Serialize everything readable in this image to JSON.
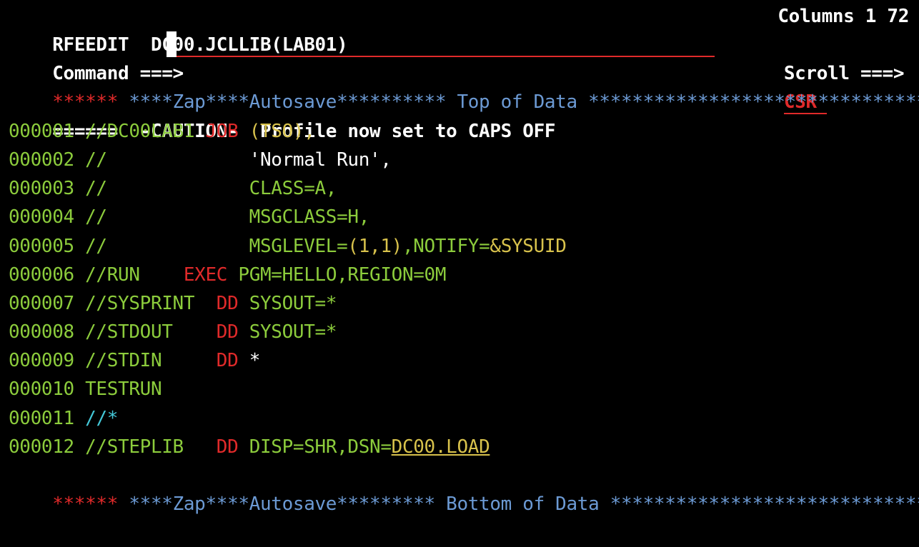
{
  "header": {
    "app": "RFEEDIT",
    "dataset": "DC00.JCLLIB(LAB01)",
    "columns_label": "Columns 1 72"
  },
  "command": {
    "label": "Command ===>",
    "value": "",
    "scroll_label": "Scroll ===>",
    "scroll_value": "CSR"
  },
  "top_marker": {
    "stars": "******",
    "text": " ****Zap****Autosave********** Top of Data *******************************"
  },
  "caution": {
    "flag": "======",
    "text": "  -CAUTION-  Profile now set to CAPS OFF"
  },
  "lines": [
    {
      "num": "000001",
      "parts": [
        {
          "t": " //DC00LAB1 ",
          "c": "green"
        },
        {
          "t": "JOB",
          "c": "red"
        },
        {
          "t": " (TSO),",
          "c": "yellow"
        }
      ]
    },
    {
      "num": "000002",
      "parts": [
        {
          "t": " //             ",
          "c": "green"
        },
        {
          "t": "'Normal Run',",
          "c": "white"
        }
      ]
    },
    {
      "num": "000003",
      "parts": [
        {
          "t": " //             CLASS=A,",
          "c": "green"
        }
      ]
    },
    {
      "num": "000004",
      "parts": [
        {
          "t": " //             MSGCLASS=H,",
          "c": "green"
        }
      ]
    },
    {
      "num": "000005",
      "parts": [
        {
          "t": " //             MSGLEVEL=",
          "c": "green"
        },
        {
          "t": "(1,1)",
          "c": "yellow"
        },
        {
          "t": ",NOTIFY=",
          "c": "green"
        },
        {
          "t": "&SYSUID",
          "c": "yellow"
        }
      ]
    },
    {
      "num": "000006",
      "parts": [
        {
          "t": " //RUN    ",
          "c": "green"
        },
        {
          "t": "EXEC",
          "c": "red"
        },
        {
          "t": " PGM=HELLO,REGION=0M",
          "c": "green"
        }
      ]
    },
    {
      "num": "000007",
      "parts": [
        {
          "t": " //SYSPRINT  ",
          "c": "green"
        },
        {
          "t": "DD",
          "c": "red"
        },
        {
          "t": " SYSOUT=*",
          "c": "green"
        }
      ]
    },
    {
      "num": "000008",
      "parts": [
        {
          "t": " //STDOUT    ",
          "c": "green"
        },
        {
          "t": "DD",
          "c": "red"
        },
        {
          "t": " SYSOUT=*",
          "c": "green"
        }
      ]
    },
    {
      "num": "000009",
      "parts": [
        {
          "t": " //STDIN     ",
          "c": "green"
        },
        {
          "t": "DD",
          "c": "red"
        },
        {
          "t": " *",
          "c": "white"
        }
      ]
    },
    {
      "num": "000010",
      "parts": [
        {
          "t": " TESTRUN",
          "c": "green"
        }
      ]
    },
    {
      "num": "000011",
      "parts": [
        {
          "t": " ",
          "c": "green"
        },
        {
          "t": "//*",
          "c": "cyan"
        }
      ]
    },
    {
      "num": "000012",
      "parts": [
        {
          "t": " //STEPLIB   ",
          "c": "green"
        },
        {
          "t": "DD",
          "c": "red"
        },
        {
          "t": " DISP=SHR,DSN=",
          "c": "green"
        },
        {
          "t": "DC00.LOAD",
          "c": "yellow",
          "u": true
        }
      ]
    }
  ],
  "bottom_marker": {
    "stars": "******",
    "text": " ****Zap****Autosave********* Bottom of Data ******************************"
  },
  "colors": {
    "background": "#000000",
    "line_number": "#8ccc3c",
    "keyword": "#e02a2a",
    "marker": "#6c9ad4",
    "literal": "#d8c24c",
    "comment": "#44c8d8"
  }
}
